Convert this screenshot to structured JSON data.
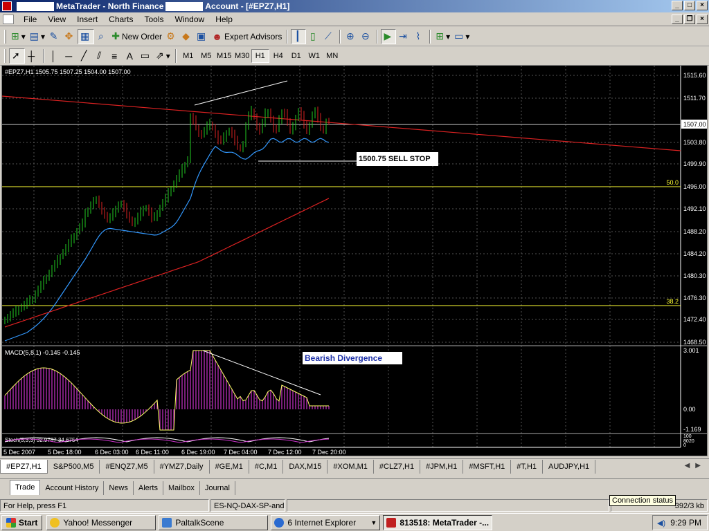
{
  "title": {
    "app": "MetaTrader - North Finance",
    "account": "Account - [#EPZ7,H1]"
  },
  "menu": [
    "File",
    "View",
    "Insert",
    "Charts",
    "Tools",
    "Window",
    "Help"
  ],
  "toolbar1": {
    "new_order": "New Order",
    "expert_advisors": "Expert Advisors"
  },
  "timeframes": [
    "M1",
    "M5",
    "M15",
    "M30",
    "H1",
    "H4",
    "D1",
    "W1",
    "MN"
  ],
  "active_timeframe": "H1",
  "chart": {
    "info": "#EPZ7,H1  1505.75 1507.25 1504.00 1507.00",
    "current_price": "1507.00",
    "price_labels": [
      "1515.60",
      "1511.70",
      "1507.00",
      "1503.80",
      "1499.90",
      "1496.00",
      "1492.10",
      "1488.20",
      "1484.20",
      "1480.30",
      "1476.30",
      "1472.40",
      "1468.50"
    ],
    "fib_50": "50.0",
    "fib_382": "38.2",
    "sell_stop": "1500.75 SELL STOP",
    "macd_info": "MACD(5,8,1) -0.145 -0.145",
    "macd_labels": [
      "3.001",
      "0.00",
      "-1.169"
    ],
    "divergence": "Bearish Divergence",
    "stoch_info": "Stoch(5,3,3) 32.9787 34.6754",
    "stoch_labels": [
      "100",
      "80",
      "20",
      "0"
    ],
    "time_labels": [
      "5 Dec 2007",
      "5 Dec 18:00",
      "6 Dec 03:00",
      "6 Dec 11:00",
      "6 Dec 19:00",
      "7 Dec 04:00",
      "7 Dec 12:00",
      "7 Dec 20:00"
    ],
    "colors": {
      "bull": "#22cc22",
      "bear": "#dd2222",
      "ma_fast": "#3399ff",
      "ma_slow": "#dd2222",
      "trend": "#dd2222",
      "fib": "#ffff33",
      "macd": "#cc33cc",
      "signal": "#ffff66"
    }
  },
  "symbol_tabs": [
    "#EPZ7,H1",
    "S&P500,M5",
    "#ENQZ7,M5",
    "#YMZ7,Daily",
    "#GE,M1",
    "#C,M1",
    "DAX,M15",
    "#XOM,M1",
    "#CLZ7,H1",
    "#JPM,H1",
    "#MSFT,H1",
    "#T,H1",
    "AUDJPY,H1"
  ],
  "terminal_tabs": [
    "Trade",
    "Account History",
    "News",
    "Alerts",
    "Mailbox",
    "Journal"
  ],
  "tooltip": "Connection status",
  "status": {
    "help": "For Help, press F1",
    "profile": "ES-NQ-DAX-SP-and o",
    "connection": "392/3 kb"
  },
  "taskbar": {
    "start": "Start",
    "items": [
      "Yahoo! Messenger",
      "PaltalkScene",
      "6 Internet Explorer",
      "813518: MetaTrader -..."
    ],
    "clock": "9:29 PM"
  }
}
